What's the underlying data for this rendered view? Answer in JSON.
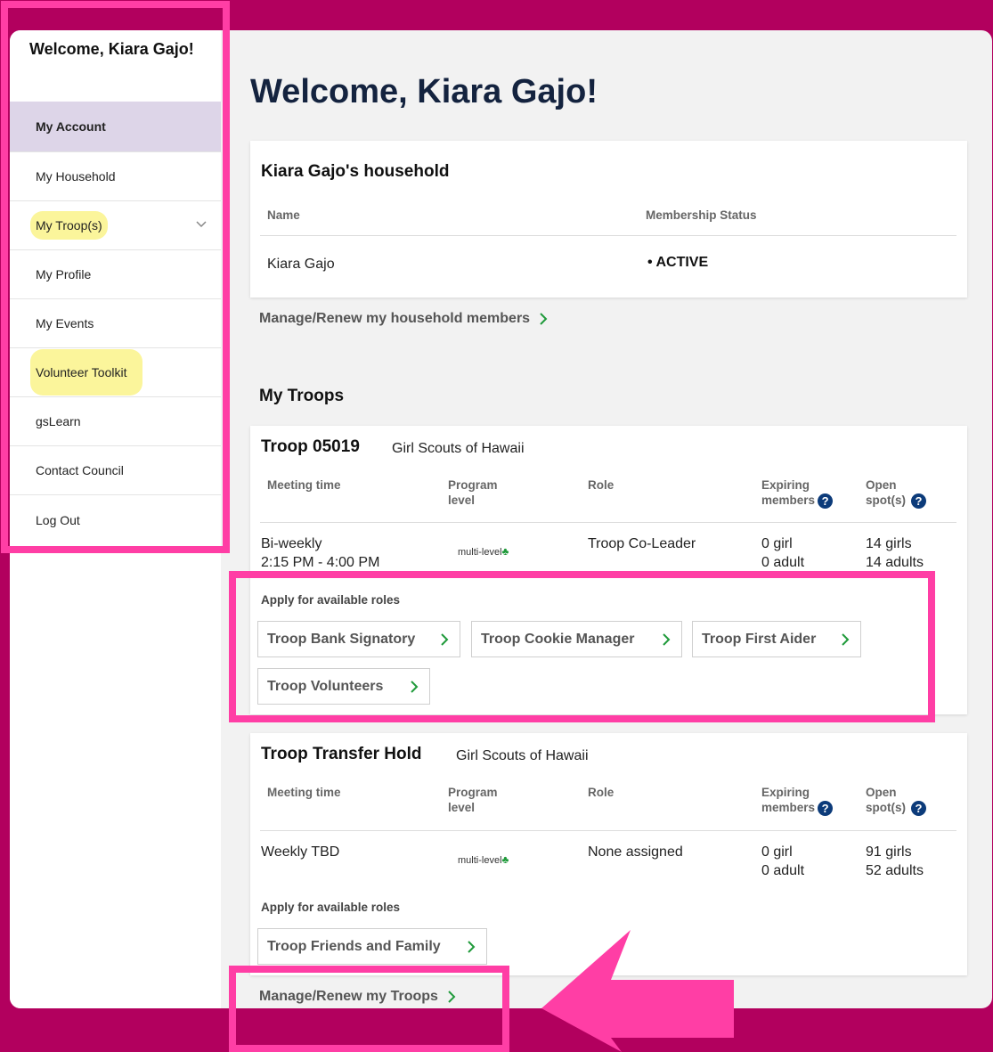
{
  "sidebar": {
    "greeting": "Welcome, Kiara Gajo!",
    "items": [
      {
        "label": "My Account"
      },
      {
        "label": "My Household"
      },
      {
        "label": "My Troop(s)"
      },
      {
        "label": "My Profile"
      },
      {
        "label": "My Events"
      },
      {
        "label": "Volunteer Toolkit"
      },
      {
        "label": "gsLearn"
      },
      {
        "label": "Contact Council"
      },
      {
        "label": "Log Out"
      }
    ]
  },
  "page": {
    "title": "Welcome, Kiara Gajo!"
  },
  "household": {
    "title": "Kiara Gajo's household",
    "col_name": "Name",
    "col_status": "Membership Status",
    "row_name": "Kiara Gajo",
    "row_status": "ACTIVE",
    "manage_link": "Manage/Renew my household members"
  },
  "troops_section": {
    "title": "My Troops",
    "manage_link": "Manage/Renew my Troops"
  },
  "headers": {
    "meeting": "Meeting time",
    "program_1": "Program",
    "program_2": "level",
    "role": "Role",
    "expiring_1": "Expiring",
    "expiring_2": "members",
    "open_1": "Open",
    "open_2": "spot(s)",
    "help": "?"
  },
  "troop1": {
    "name": "Troop 05019",
    "council": "Girl Scouts of Hawaii",
    "meeting_1": "Bi-weekly",
    "meeting_2": "2:15 PM - 4:00 PM",
    "program": "multi-level",
    "role": "Troop Co-Leader",
    "expiring_girl": "0 girl",
    "expiring_adult": "0 adult",
    "open_girls": "14 girls",
    "open_adults": "14 adults",
    "apply_title": "Apply for available roles",
    "roles": [
      "Troop Bank Signatory",
      "Troop Cookie Manager",
      "Troop First Aider",
      "Troop Volunteers"
    ]
  },
  "troop2": {
    "name": "Troop Transfer Hold",
    "council": "Girl Scouts of Hawaii",
    "meeting_1": "Weekly TBD",
    "program": "multi-level",
    "role": "None assigned",
    "expiring_girl": "0 girl",
    "expiring_adult": "0 adult",
    "open_girls": "91 girls",
    "open_adults": "52 adults",
    "apply_title": "Apply for available roles",
    "roles": [
      "Troop Friends and Family"
    ]
  },
  "colors": {
    "background": "#b2005e",
    "highlight_box": "#ff3ea5",
    "text_highlight": "#fbf59b",
    "active_nav": "#ddd5e8",
    "chevron": "#1f9a3a",
    "help_icon": "#0c3b7a"
  }
}
